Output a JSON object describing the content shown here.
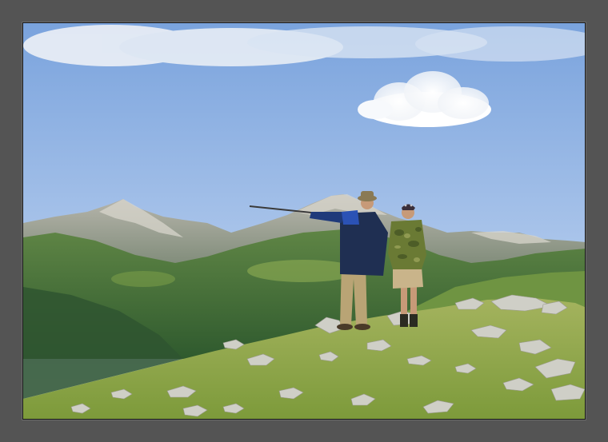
{
  "scene": {
    "subject": "photo",
    "colors": {
      "frame": "#545454",
      "sky_top": "#7fa6dc",
      "sky_bottom": "#c9dbef",
      "mountain_far": "#8e9aa0",
      "mountain_near": "#4e6e3e",
      "meadow": "#8aa24a",
      "rock": "#c9c9c2"
    }
  }
}
